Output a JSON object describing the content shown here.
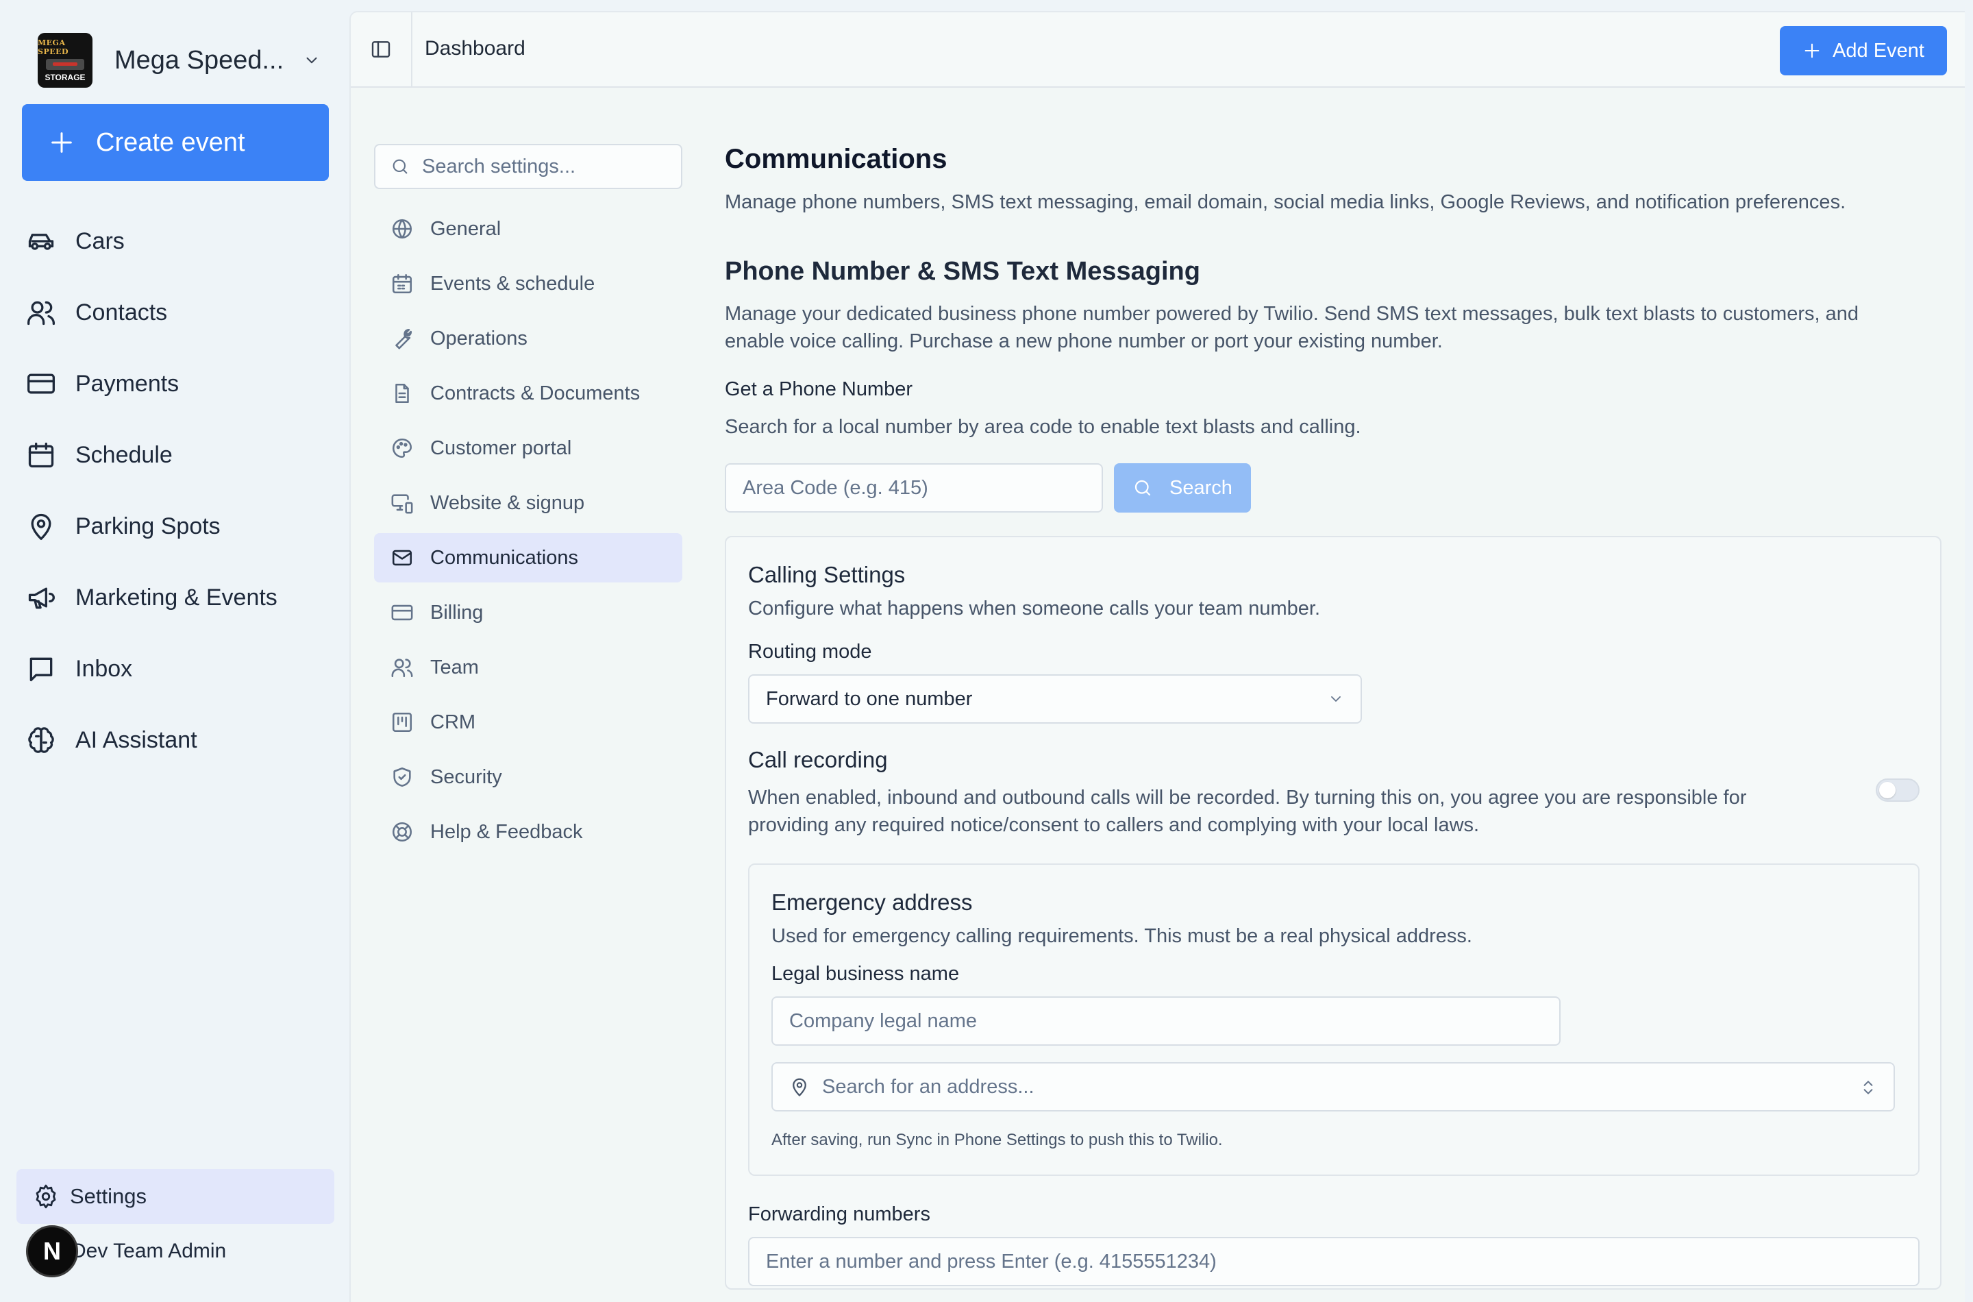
{
  "brand": {
    "name": "Mega Speed...",
    "logo_line1": "MEGA SPEED",
    "logo_line2": "STORAGE"
  },
  "sidebar": {
    "create_label": "Create event",
    "items": [
      {
        "label": "Cars",
        "icon": "car-icon"
      },
      {
        "label": "Contacts",
        "icon": "users-icon"
      },
      {
        "label": "Payments",
        "icon": "credit-card-icon"
      },
      {
        "label": "Schedule",
        "icon": "calendar-icon"
      },
      {
        "label": "Parking Spots",
        "icon": "map-pin-icon"
      },
      {
        "label": "Marketing & Events",
        "icon": "megaphone-icon"
      },
      {
        "label": "Inbox",
        "icon": "message-square-icon"
      },
      {
        "label": "AI Assistant",
        "icon": "brain-icon"
      }
    ],
    "settings_label": "Settings",
    "user_initial": "N",
    "user_name": "Dev Team Admin"
  },
  "topbar": {
    "breadcrumb": "Dashboard",
    "add_event_label": "Add Event"
  },
  "settings_nav": {
    "search_placeholder": "Search settings...",
    "items": [
      {
        "label": "General",
        "icon": "globe-icon"
      },
      {
        "label": "Events & schedule",
        "icon": "calendar-icon"
      },
      {
        "label": "Operations",
        "icon": "wrench-icon"
      },
      {
        "label": "Contracts & Documents",
        "icon": "file-text-icon"
      },
      {
        "label": "Customer portal",
        "icon": "palette-icon"
      },
      {
        "label": "Website & signup",
        "icon": "monitor-smartphone-icon"
      },
      {
        "label": "Communications",
        "icon": "mail-icon",
        "active": true
      },
      {
        "label": "Billing",
        "icon": "credit-card-icon"
      },
      {
        "label": "Team",
        "icon": "users-icon"
      },
      {
        "label": "CRM",
        "icon": "kanban-icon"
      },
      {
        "label": "Security",
        "icon": "shield-check-icon"
      },
      {
        "label": "Help & Feedback",
        "icon": "life-buoy-icon"
      }
    ]
  },
  "content": {
    "title": "Communications",
    "subtitle": "Manage phone numbers, SMS text messaging, email domain, social media links, Google Reviews, and notification preferences.",
    "phone_section": {
      "title": "Phone Number & SMS Text Messaging",
      "description": "Manage your dedicated business phone number powered by Twilio. Send SMS text messages, bulk text blasts to customers, and enable voice calling. Purchase a new phone number or port your existing number.",
      "get_number_title": "Get a Phone Number",
      "get_number_desc": "Search for a local number by area code to enable text blasts and calling.",
      "area_code_placeholder": "Area Code (e.g. 415)",
      "search_label": "Search"
    },
    "calling": {
      "title": "Calling Settings",
      "subtitle": "Configure what happens when someone calls your team number.",
      "routing_label": "Routing mode",
      "routing_value": "Forward to one number",
      "recording_title": "Call recording",
      "recording_desc": "When enabled, inbound and outbound calls will be recorded. By turning this on, you agree you are responsible for providing any required notice/consent to callers and complying with your local laws.",
      "recording_enabled": false,
      "emergency": {
        "title": "Emergency address",
        "subtitle": "Used for emergency calling requirements. This must be a real physical address.",
        "legal_label": "Legal business name",
        "legal_placeholder": "Company legal name",
        "address_placeholder": "Search for an address...",
        "note": "After saving, run Sync in Phone Settings to push this to Twilio."
      },
      "forwarding_label": "Forwarding numbers",
      "forwarding_placeholder": "Enter a number and press Enter (e.g. 4155551234)"
    }
  },
  "colors": {
    "accent": "#3b82f6",
    "active_bg": "#e2e7fb"
  }
}
